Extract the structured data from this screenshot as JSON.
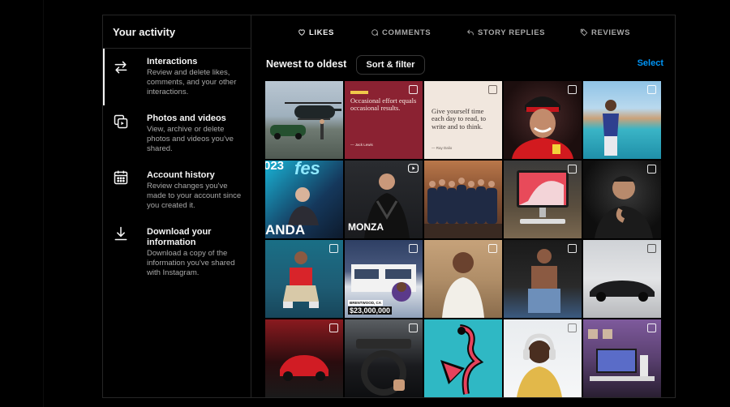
{
  "sidebar": {
    "title": "Your activity",
    "items": [
      {
        "title": "Interactions",
        "desc": "Review and delete likes, comments, and your other interactions.",
        "icon": "arrows-swap-icon"
      },
      {
        "title": "Photos and videos",
        "desc": "View, archive or delete photos and videos you've shared.",
        "icon": "photos-videos-icon"
      },
      {
        "title": "Account history",
        "desc": "Review changes you've made to your account since you created it.",
        "icon": "calendar-icon"
      },
      {
        "title": "Download your information",
        "desc": "Download a copy of the information you've shared with Instagram.",
        "icon": "download-icon"
      }
    ]
  },
  "tabs": [
    {
      "label": "LIKES",
      "icon": "heart-icon",
      "active": true
    },
    {
      "label": "COMMENTS",
      "icon": "comment-icon",
      "active": false
    },
    {
      "label": "STORY REPLIES",
      "icon": "reply-icon",
      "active": false
    },
    {
      "label": "REVIEWS",
      "icon": "tag-icon",
      "active": false
    }
  ],
  "toolbar": {
    "sort_label": "Newest to oldest",
    "filter_button": "Sort & filter",
    "select_label": "Select"
  },
  "tiles": {
    "t2_text": "Occasional effort equals occasional results.",
    "t2_author": "— Jack Lewis",
    "t3_text": "Give yourself time each day to read, to write and to think.",
    "t3_author": "— Ray Dalio",
    "t6_text": "MONZA",
    "t6b_text": "ANDA",
    "t6c_text": "fes",
    "t6d_text": "023",
    "t12_location": "BRENTWOOD, CA",
    "t12_price": "$23,000,000"
  },
  "colors": {
    "accent": "#0095f6",
    "border": "#262626",
    "muted_text": "#a8a8a8"
  }
}
